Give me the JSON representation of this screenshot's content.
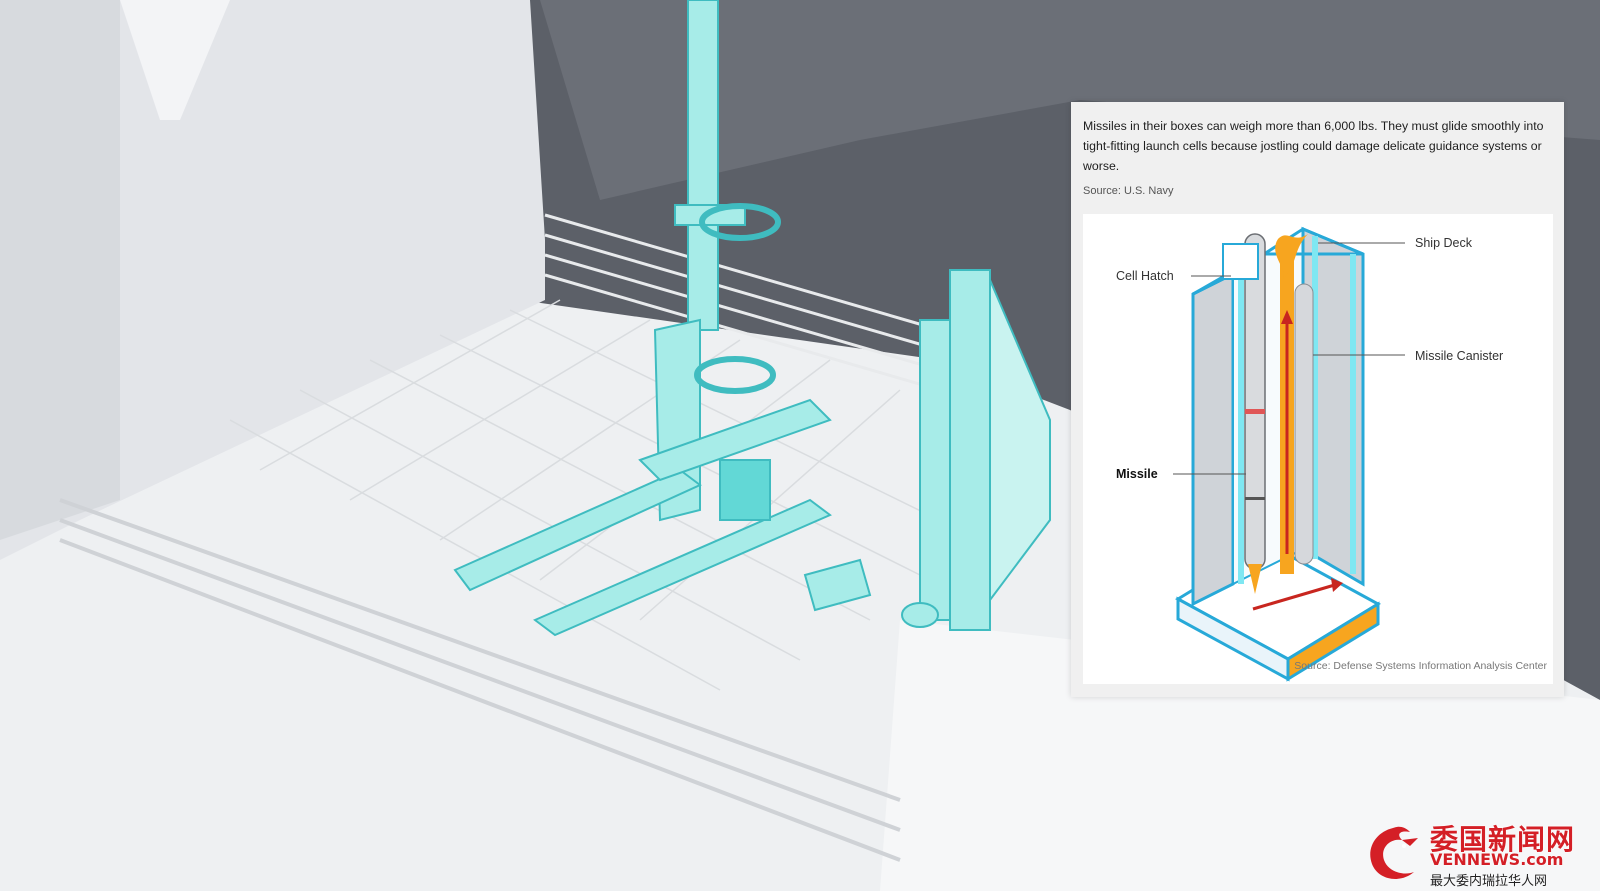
{
  "overlay": {
    "caption": "Missiles in their boxes can weigh more than 6,000 lbs. They must glide smoothly into tight-fitting launch cells because jostling could damage delicate guidance systems or worse.",
    "source_top": "Source: U.S. Navy",
    "diagram": {
      "labels": {
        "ship_deck": "Ship Deck",
        "cell_hatch": "Cell Hatch",
        "missile_canister": "Missile Canister",
        "missile": "Missile"
      },
      "source": "Source: Defense Systems Information Analysis Center"
    }
  },
  "watermark": {
    "title": "委国新闻网",
    "domain": "VENNEWS.com",
    "slogan": "最大委内瑞拉华人网"
  },
  "colors": {
    "sky_dark": "#5c6068",
    "deck": "#f4f5f6",
    "equipment_cyan": "#a7ece8",
    "equipment_cyan_dark": "#3fbcc0",
    "diagram_cyan": "#27c7e0",
    "diagram_orange": "#f7a51f",
    "diagram_red": "#c8261f",
    "watermark_red": "#d41f26"
  }
}
